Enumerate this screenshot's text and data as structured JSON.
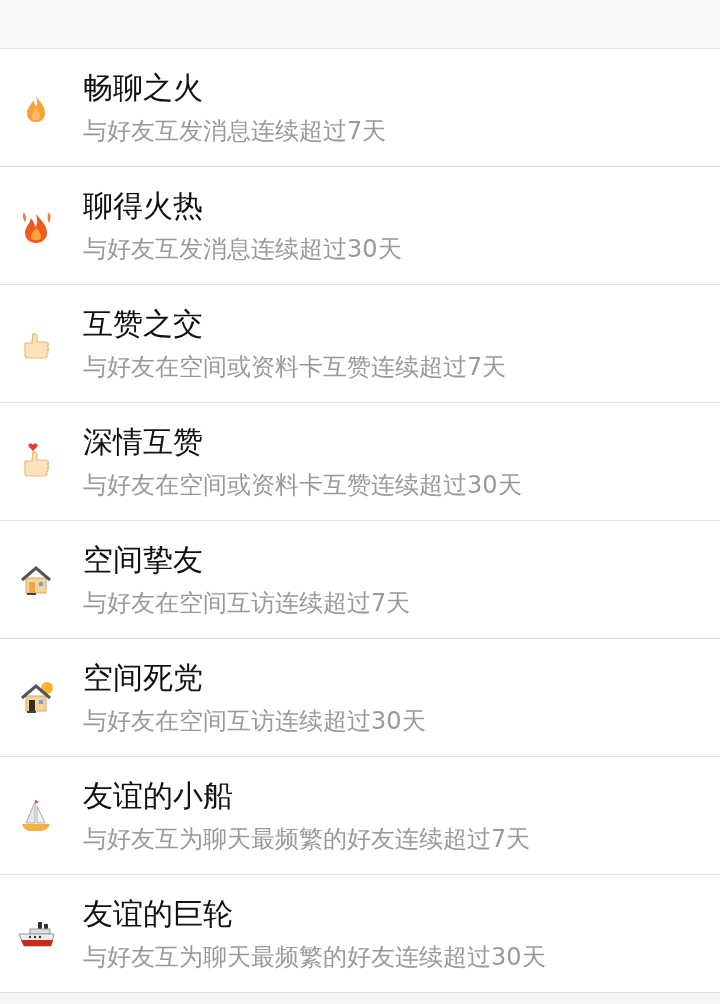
{
  "achievements": [
    {
      "kind": "flame",
      "title": "畅聊之火",
      "description": "与好友互发消息连续超过7天"
    },
    {
      "kind": "big-flame",
      "title": "聊得火热",
      "description": "与好友互发消息连续超过30天"
    },
    {
      "kind": "thumb",
      "title": "互赞之交",
      "description": "与好友在空间或资料卡互赞连续超过7天"
    },
    {
      "kind": "heart-thumb",
      "title": "深情互赞",
      "description": "与好友在空间或资料卡互赞连续超过30天"
    },
    {
      "kind": "house",
      "title": "空间挚友",
      "description": "与好友在空间互访连续超过7天"
    },
    {
      "kind": "sun-house",
      "title": "空间死党",
      "description": "与好友在空间互访连续超过30天"
    },
    {
      "kind": "sailboat",
      "title": "友谊的小船",
      "description": "与好友互为聊天最频繁的好友连续超过7天"
    },
    {
      "kind": "ship",
      "title": "友谊的巨轮",
      "description": "与好友互为聊天最频繁的好友连续超过30天"
    }
  ]
}
